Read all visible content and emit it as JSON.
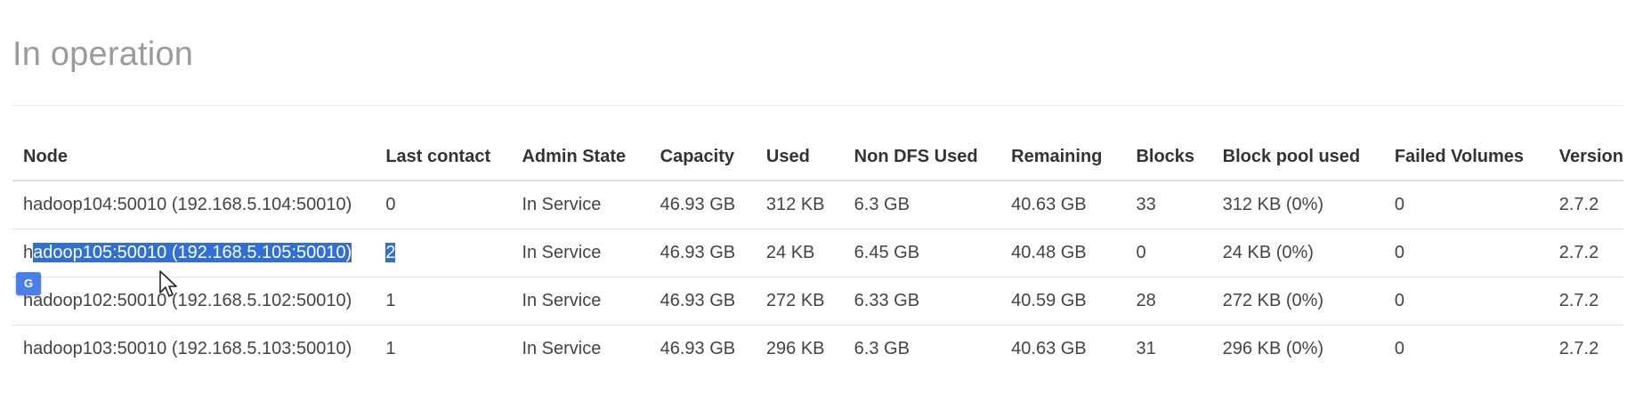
{
  "heading": "In operation",
  "table": {
    "headers": [
      "Node",
      "Last contact",
      "Admin State",
      "Capacity",
      "Used",
      "Non DFS Used",
      "Remaining",
      "Blocks",
      "Block pool used",
      "Failed Volumes",
      "Version"
    ],
    "rows": [
      {
        "node_pre": "hadoop104:50010 (192.168.5.104:50010)",
        "node_sel": "",
        "last_contact": "0",
        "admin_state": "In Service",
        "capacity": "46.93 GB",
        "used": "312 KB",
        "non_dfs_used": "6.3 GB",
        "remaining": "40.63 GB",
        "blocks": "33",
        "block_pool_used": "312 KB (0%)",
        "failed_volumes": "0",
        "version": "2.7.2"
      },
      {
        "node_pre": "h",
        "node_sel": "adoop105:50010 (192.168.5.105:50010)",
        "last_contact": "2",
        "admin_state": "In Service",
        "capacity": "46.93 GB",
        "used": "24 KB",
        "non_dfs_used": "6.45 GB",
        "remaining": "40.48 GB",
        "blocks": "0",
        "block_pool_used": "24 KB (0%)",
        "failed_volumes": "0",
        "version": "2.7.2"
      },
      {
        "node_pre": "hadoop102:50010 (192.168.5.102:50010)",
        "node_sel": "",
        "last_contact": "1",
        "admin_state": "In Service",
        "capacity": "46.93 GB",
        "used": "272 KB",
        "non_dfs_used": "6.33 GB",
        "remaining": "40.59 GB",
        "blocks": "28",
        "block_pool_used": "272 KB (0%)",
        "failed_volumes": "0",
        "version": "2.7.2"
      },
      {
        "node_pre": "hadoop103:50010 (192.168.5.103:50010)",
        "node_sel": "",
        "last_contact": "1",
        "admin_state": "In Service",
        "capacity": "46.93 GB",
        "used": "296 KB",
        "non_dfs_used": "6.3 GB",
        "remaining": "40.63 GB",
        "blocks": "31",
        "block_pool_used": "296 KB (0%)",
        "failed_volumes": "0",
        "version": "2.7.2"
      }
    ]
  },
  "translate_icon": {
    "name": "google-translate-icon",
    "label": "G"
  },
  "colors": {
    "selection": "#2f6fd6",
    "heading": "#9b9b9b"
  }
}
